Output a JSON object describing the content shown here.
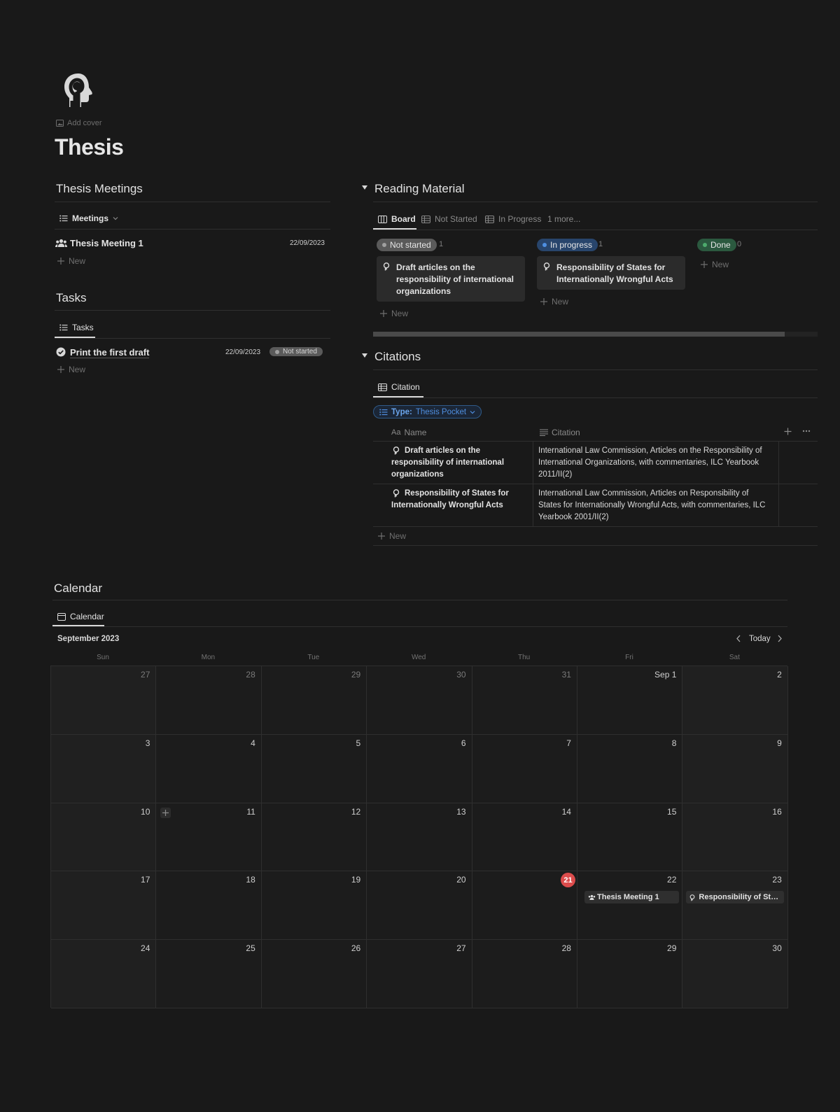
{
  "page": {
    "add_cover": "Add cover",
    "title": "Thesis"
  },
  "meetings": {
    "title": "Thesis Meetings",
    "view_label": "Meetings",
    "rows": [
      {
        "title": "Thesis Meeting 1",
        "date": "22/09/2023"
      }
    ],
    "new_label": "New"
  },
  "tasks": {
    "title": "Tasks",
    "view_label": "Tasks",
    "rows": [
      {
        "title": "Print the first draft",
        "date": "22/09/2023",
        "status": "Not started"
      }
    ],
    "new_label": "New"
  },
  "reading": {
    "title": "Reading Material",
    "tabs": [
      "Board",
      "Not Started",
      "In Progress",
      "1 more..."
    ],
    "columns": [
      {
        "label": "Not started",
        "count": "1",
        "cards": [
          "Draft articles on the responsibility of international organizations"
        ],
        "new_label": "New",
        "color": "#5a5a5a",
        "dot": "#a0a0a0"
      },
      {
        "label": "In progress",
        "count": "1",
        "cards": [
          "Responsibility of States for Internationally Wrongful Acts"
        ],
        "new_label": "New",
        "color": "#28456c",
        "dot": "#4f8fe0"
      },
      {
        "label": "Done",
        "count": "0",
        "cards": [],
        "new_label": "New",
        "color": "#2b593f",
        "dot": "#4dab6d"
      }
    ]
  },
  "citations": {
    "title": "Citations",
    "view_label": "Citation",
    "filter_key": "Type:",
    "filter_value": "Thesis Pocket",
    "columns": [
      "Name",
      "Citation"
    ],
    "rows": [
      {
        "name": "Draft articles on the responsibility of international organizations",
        "citation": "International Law Commission, Articles on the Responsibility of International Organizations, with commentaries, ILC Yearbook 2011/II(2)"
      },
      {
        "name": "Responsibility of States for Internationally Wrongful Acts",
        "citation": "International Law Commission, Articles on Responsibility of States for Internationally Wrongful Acts, with commentaries, ILC Yearbook 2001/II(2)"
      }
    ],
    "new_label": "New"
  },
  "calendar": {
    "title": "Calendar",
    "view_label": "Calendar",
    "month": "September 2023",
    "today_label": "Today",
    "weekdays": [
      "Sun",
      "Mon",
      "Tue",
      "Wed",
      "Thu",
      "Fri",
      "Sat"
    ],
    "weeks": [
      [
        "27",
        "28",
        "29",
        "30",
        "31",
        "Sep 1",
        "2"
      ],
      [
        "3",
        "4",
        "5",
        "6",
        "7",
        "8",
        "9"
      ],
      [
        "10",
        "11",
        "12",
        "13",
        "14",
        "15",
        "16"
      ],
      [
        "17",
        "18",
        "19",
        "20",
        "21",
        "22",
        "23"
      ],
      [
        "24",
        "25",
        "26",
        "27",
        "28",
        "29",
        "30"
      ]
    ],
    "today": "21",
    "events": [
      {
        "label": "Thesis Meeting 1",
        "icon": "people-icon"
      },
      {
        "label": "Responsibility of Stat...",
        "icon": "head-icon"
      }
    ],
    "today_color": "#dc4c4c"
  }
}
